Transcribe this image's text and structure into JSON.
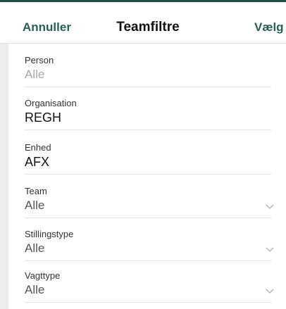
{
  "header": {
    "cancel_label": "Annuller",
    "title": "Teamfiltre",
    "select_label": "Vælg"
  },
  "fields": {
    "person": {
      "label": "Person",
      "value": "Alle"
    },
    "organisation": {
      "label": "Organisation",
      "value": "REGH"
    },
    "enhed": {
      "label": "Enhed",
      "value": "AFX"
    },
    "team": {
      "label": "Team",
      "value": "Alle"
    },
    "stillingstype": {
      "label": "Stillingstype",
      "value": "Alle"
    },
    "vagttype": {
      "label": "Vagttype",
      "value": "Alle"
    }
  },
  "icons": {
    "dropdown": "chevron-down-icon"
  },
  "colors": {
    "accent": "#2a5d53",
    "top_rule": "#1f4d44",
    "muted_value": "#a9a9a9"
  }
}
